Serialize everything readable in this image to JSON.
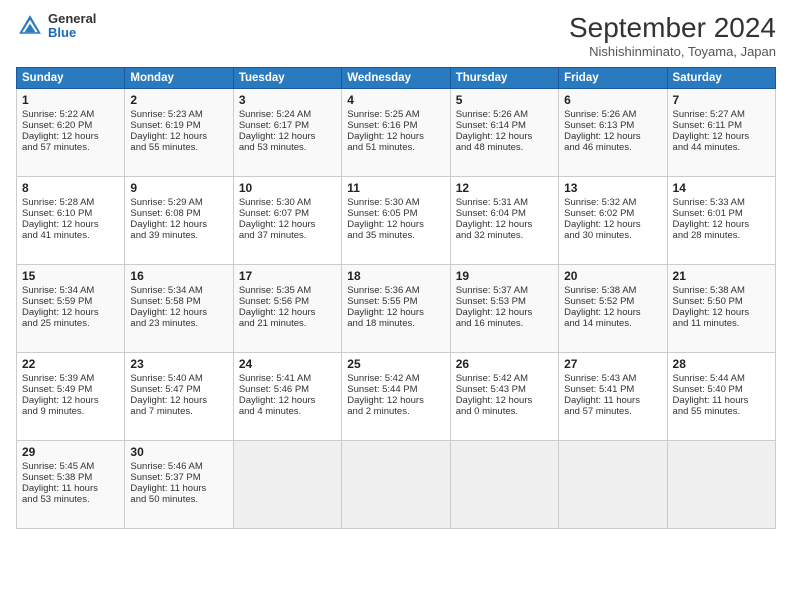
{
  "header": {
    "logo_general": "General",
    "logo_blue": "Blue",
    "month_title": "September 2024",
    "location": "Nishishinminato, Toyama, Japan"
  },
  "weekdays": [
    "Sunday",
    "Monday",
    "Tuesday",
    "Wednesday",
    "Thursday",
    "Friday",
    "Saturday"
  ],
  "weeks": [
    [
      {
        "day": "1",
        "lines": [
          "Sunrise: 5:22 AM",
          "Sunset: 6:20 PM",
          "Daylight: 12 hours",
          "and 57 minutes."
        ]
      },
      {
        "day": "2",
        "lines": [
          "Sunrise: 5:23 AM",
          "Sunset: 6:19 PM",
          "Daylight: 12 hours",
          "and 55 minutes."
        ]
      },
      {
        "day": "3",
        "lines": [
          "Sunrise: 5:24 AM",
          "Sunset: 6:17 PM",
          "Daylight: 12 hours",
          "and 53 minutes."
        ]
      },
      {
        "day": "4",
        "lines": [
          "Sunrise: 5:25 AM",
          "Sunset: 6:16 PM",
          "Daylight: 12 hours",
          "and 51 minutes."
        ]
      },
      {
        "day": "5",
        "lines": [
          "Sunrise: 5:26 AM",
          "Sunset: 6:14 PM",
          "Daylight: 12 hours",
          "and 48 minutes."
        ]
      },
      {
        "day": "6",
        "lines": [
          "Sunrise: 5:26 AM",
          "Sunset: 6:13 PM",
          "Daylight: 12 hours",
          "and 46 minutes."
        ]
      },
      {
        "day": "7",
        "lines": [
          "Sunrise: 5:27 AM",
          "Sunset: 6:11 PM",
          "Daylight: 12 hours",
          "and 44 minutes."
        ]
      }
    ],
    [
      {
        "day": "8",
        "lines": [
          "Sunrise: 5:28 AM",
          "Sunset: 6:10 PM",
          "Daylight: 12 hours",
          "and 41 minutes."
        ]
      },
      {
        "day": "9",
        "lines": [
          "Sunrise: 5:29 AM",
          "Sunset: 6:08 PM",
          "Daylight: 12 hours",
          "and 39 minutes."
        ]
      },
      {
        "day": "10",
        "lines": [
          "Sunrise: 5:30 AM",
          "Sunset: 6:07 PM",
          "Daylight: 12 hours",
          "and 37 minutes."
        ]
      },
      {
        "day": "11",
        "lines": [
          "Sunrise: 5:30 AM",
          "Sunset: 6:05 PM",
          "Daylight: 12 hours",
          "and 35 minutes."
        ]
      },
      {
        "day": "12",
        "lines": [
          "Sunrise: 5:31 AM",
          "Sunset: 6:04 PM",
          "Daylight: 12 hours",
          "and 32 minutes."
        ]
      },
      {
        "day": "13",
        "lines": [
          "Sunrise: 5:32 AM",
          "Sunset: 6:02 PM",
          "Daylight: 12 hours",
          "and 30 minutes."
        ]
      },
      {
        "day": "14",
        "lines": [
          "Sunrise: 5:33 AM",
          "Sunset: 6:01 PM",
          "Daylight: 12 hours",
          "and 28 minutes."
        ]
      }
    ],
    [
      {
        "day": "15",
        "lines": [
          "Sunrise: 5:34 AM",
          "Sunset: 5:59 PM",
          "Daylight: 12 hours",
          "and 25 minutes."
        ]
      },
      {
        "day": "16",
        "lines": [
          "Sunrise: 5:34 AM",
          "Sunset: 5:58 PM",
          "Daylight: 12 hours",
          "and 23 minutes."
        ]
      },
      {
        "day": "17",
        "lines": [
          "Sunrise: 5:35 AM",
          "Sunset: 5:56 PM",
          "Daylight: 12 hours",
          "and 21 minutes."
        ]
      },
      {
        "day": "18",
        "lines": [
          "Sunrise: 5:36 AM",
          "Sunset: 5:55 PM",
          "Daylight: 12 hours",
          "and 18 minutes."
        ]
      },
      {
        "day": "19",
        "lines": [
          "Sunrise: 5:37 AM",
          "Sunset: 5:53 PM",
          "Daylight: 12 hours",
          "and 16 minutes."
        ]
      },
      {
        "day": "20",
        "lines": [
          "Sunrise: 5:38 AM",
          "Sunset: 5:52 PM",
          "Daylight: 12 hours",
          "and 14 minutes."
        ]
      },
      {
        "day": "21",
        "lines": [
          "Sunrise: 5:38 AM",
          "Sunset: 5:50 PM",
          "Daylight: 12 hours",
          "and 11 minutes."
        ]
      }
    ],
    [
      {
        "day": "22",
        "lines": [
          "Sunrise: 5:39 AM",
          "Sunset: 5:49 PM",
          "Daylight: 12 hours",
          "and 9 minutes."
        ]
      },
      {
        "day": "23",
        "lines": [
          "Sunrise: 5:40 AM",
          "Sunset: 5:47 PM",
          "Daylight: 12 hours",
          "and 7 minutes."
        ]
      },
      {
        "day": "24",
        "lines": [
          "Sunrise: 5:41 AM",
          "Sunset: 5:46 PM",
          "Daylight: 12 hours",
          "and 4 minutes."
        ]
      },
      {
        "day": "25",
        "lines": [
          "Sunrise: 5:42 AM",
          "Sunset: 5:44 PM",
          "Daylight: 12 hours",
          "and 2 minutes."
        ]
      },
      {
        "day": "26",
        "lines": [
          "Sunrise: 5:42 AM",
          "Sunset: 5:43 PM",
          "Daylight: 12 hours",
          "and 0 minutes."
        ]
      },
      {
        "day": "27",
        "lines": [
          "Sunrise: 5:43 AM",
          "Sunset: 5:41 PM",
          "Daylight: 11 hours",
          "and 57 minutes."
        ]
      },
      {
        "day": "28",
        "lines": [
          "Sunrise: 5:44 AM",
          "Sunset: 5:40 PM",
          "Daylight: 11 hours",
          "and 55 minutes."
        ]
      }
    ],
    [
      {
        "day": "29",
        "lines": [
          "Sunrise: 5:45 AM",
          "Sunset: 5:38 PM",
          "Daylight: 11 hours",
          "and 53 minutes."
        ]
      },
      {
        "day": "30",
        "lines": [
          "Sunrise: 5:46 AM",
          "Sunset: 5:37 PM",
          "Daylight: 11 hours",
          "and 50 minutes."
        ]
      },
      {
        "day": "",
        "lines": []
      },
      {
        "day": "",
        "lines": []
      },
      {
        "day": "",
        "lines": []
      },
      {
        "day": "",
        "lines": []
      },
      {
        "day": "",
        "lines": []
      }
    ]
  ]
}
